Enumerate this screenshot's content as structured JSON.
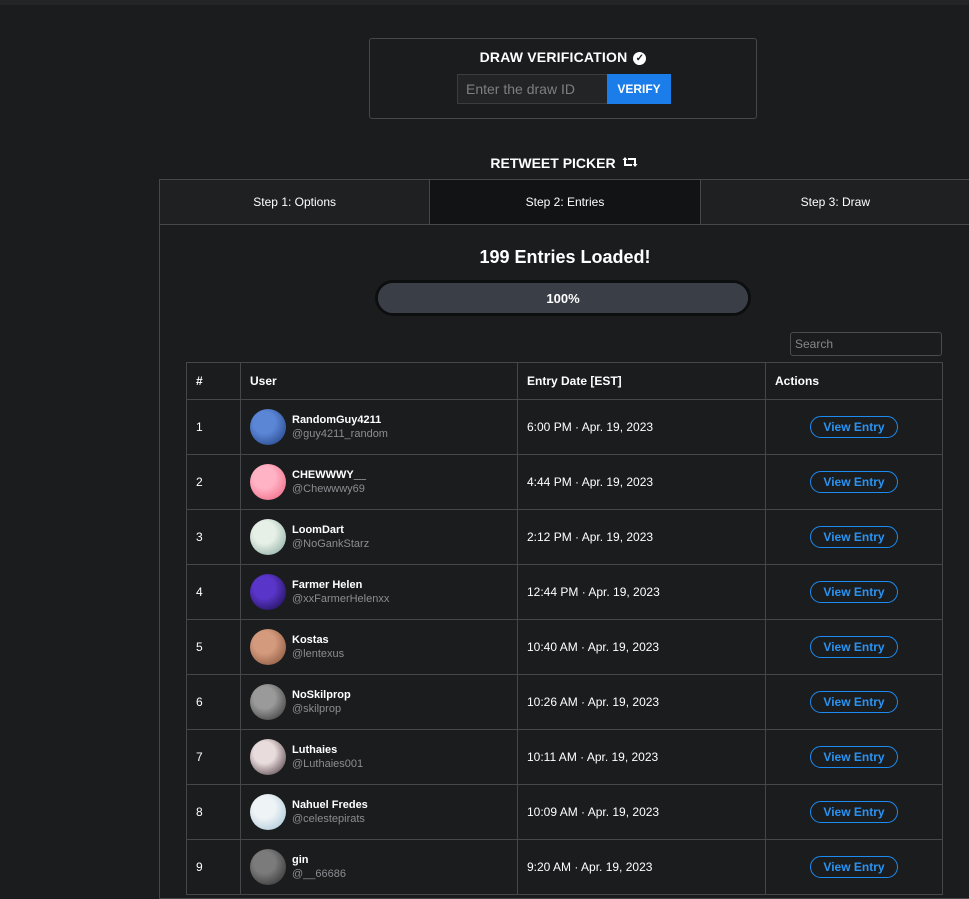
{
  "verification": {
    "title": "DRAW VERIFICATION",
    "check_icon": "check-circle-icon",
    "input_placeholder": "Enter the draw ID",
    "verify_label": "VERIFY"
  },
  "picker": {
    "title": "RETWEET PICKER",
    "icon": "retweet-icon",
    "tabs": [
      {
        "label": "Step 1: Options",
        "active": false
      },
      {
        "label": "Step 2: Entries",
        "active": true
      },
      {
        "label": "Step 3: Draw",
        "active": false
      }
    ],
    "loaded_text": "199 Entries Loaded!",
    "progress": {
      "percent": 100,
      "label": "100%"
    },
    "search_placeholder": "Search"
  },
  "table": {
    "headers": [
      "#",
      "User",
      "Entry Date [EST]",
      "Actions"
    ],
    "action_label": "View Entry",
    "rows": [
      {
        "num": "1",
        "name": "RandomGuy4211",
        "handle": "@guy4211_random",
        "date": "6:00 PM · Apr. 19, 2023",
        "avatar_colors": [
          "#5b86d6",
          "#1d3b7a"
        ]
      },
      {
        "num": "2",
        "name": "CHEWWWY__",
        "handle": "@Chewwwy69",
        "date": "4:44 PM · Apr. 19, 2023",
        "avatar_colors": [
          "#ffb3c4",
          "#ee5b7d"
        ]
      },
      {
        "num": "3",
        "name": "LoomDart",
        "handle": "@NoGankStarz",
        "date": "2:12 PM · Apr. 19, 2023",
        "avatar_colors": [
          "#e7f0e6",
          "#7ea39b"
        ]
      },
      {
        "num": "4",
        "name": "Farmer Helen",
        "handle": "@xxFarmerHelenxx",
        "date": "12:44 PM · Apr. 19, 2023",
        "avatar_colors": [
          "#5a35c9",
          "#140a3e"
        ]
      },
      {
        "num": "5",
        "name": "Kostas",
        "handle": "@lentexus",
        "date": "10:40 AM · Apr. 19, 2023",
        "avatar_colors": [
          "#d49a7d",
          "#7a4a33"
        ]
      },
      {
        "num": "6",
        "name": "NoSkilprop",
        "handle": "@skilprop",
        "date": "10:26 AM · Apr. 19, 2023",
        "avatar_colors": [
          "#9a9a9a",
          "#2b2b2b"
        ]
      },
      {
        "num": "7",
        "name": "Luthaies",
        "handle": "@Luthaies001",
        "date": "10:11 AM · Apr. 19, 2023",
        "avatar_colors": [
          "#e9dcdc",
          "#3b2730"
        ]
      },
      {
        "num": "8",
        "name": "Nahuel Fredes",
        "handle": "@celestepirats",
        "date": "10:09 AM · Apr. 19, 2023",
        "avatar_colors": [
          "#eef3f6",
          "#9fc0d2"
        ]
      },
      {
        "num": "9",
        "name": "gin",
        "handle": "@__66686",
        "date": "9:20 AM · Apr. 19, 2023",
        "avatar_colors": [
          "#7b7b7b",
          "#262626"
        ]
      }
    ]
  }
}
